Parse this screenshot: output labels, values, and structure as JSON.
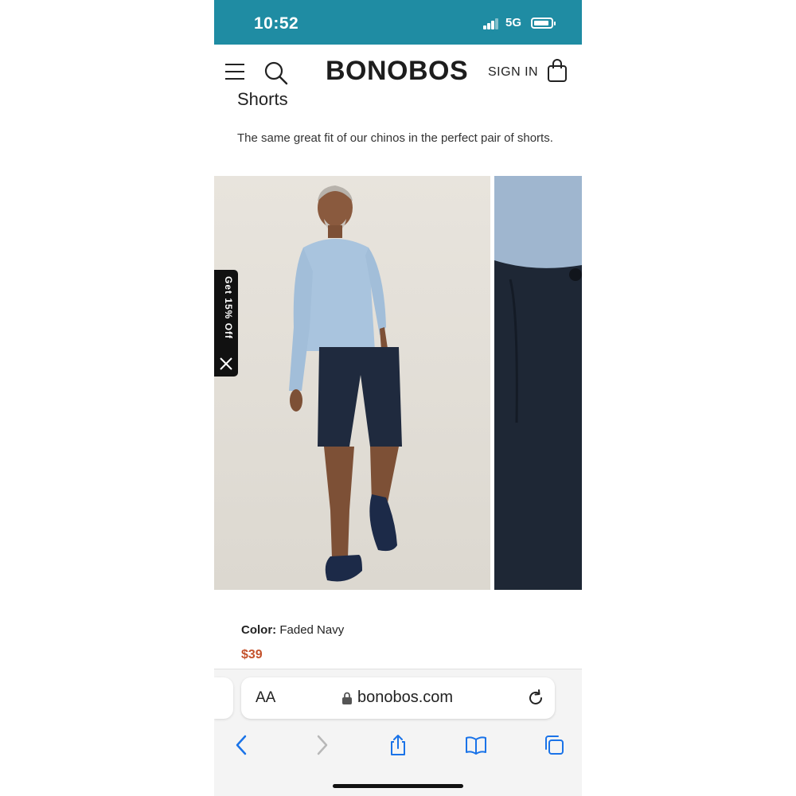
{
  "status_bar": {
    "time": "10:52",
    "network": "5G",
    "color": "#1f8ca3"
  },
  "header": {
    "brand": "BONOBOS",
    "sign_in": "SIGN IN",
    "icons": [
      "menu-icon",
      "search-icon",
      "shopping-bag-icon"
    ]
  },
  "product": {
    "title_partial": "Shorts",
    "description": "The same great fit of our chinos in the perfect pair of shorts.",
    "color_label": "Color:",
    "color_value": "Faded Navy",
    "price": "$39"
  },
  "promo": {
    "label": "Get 15% Off"
  },
  "browser": {
    "text_size": "AA",
    "url": "bonobos.com",
    "icons": [
      "back-icon",
      "forward-icon",
      "share-icon",
      "bookmarks-icon",
      "tabs-icon",
      "reload-icon",
      "lock-icon"
    ]
  },
  "colors": {
    "price": "#c4522c",
    "brand_text": "#1d1d1d"
  }
}
